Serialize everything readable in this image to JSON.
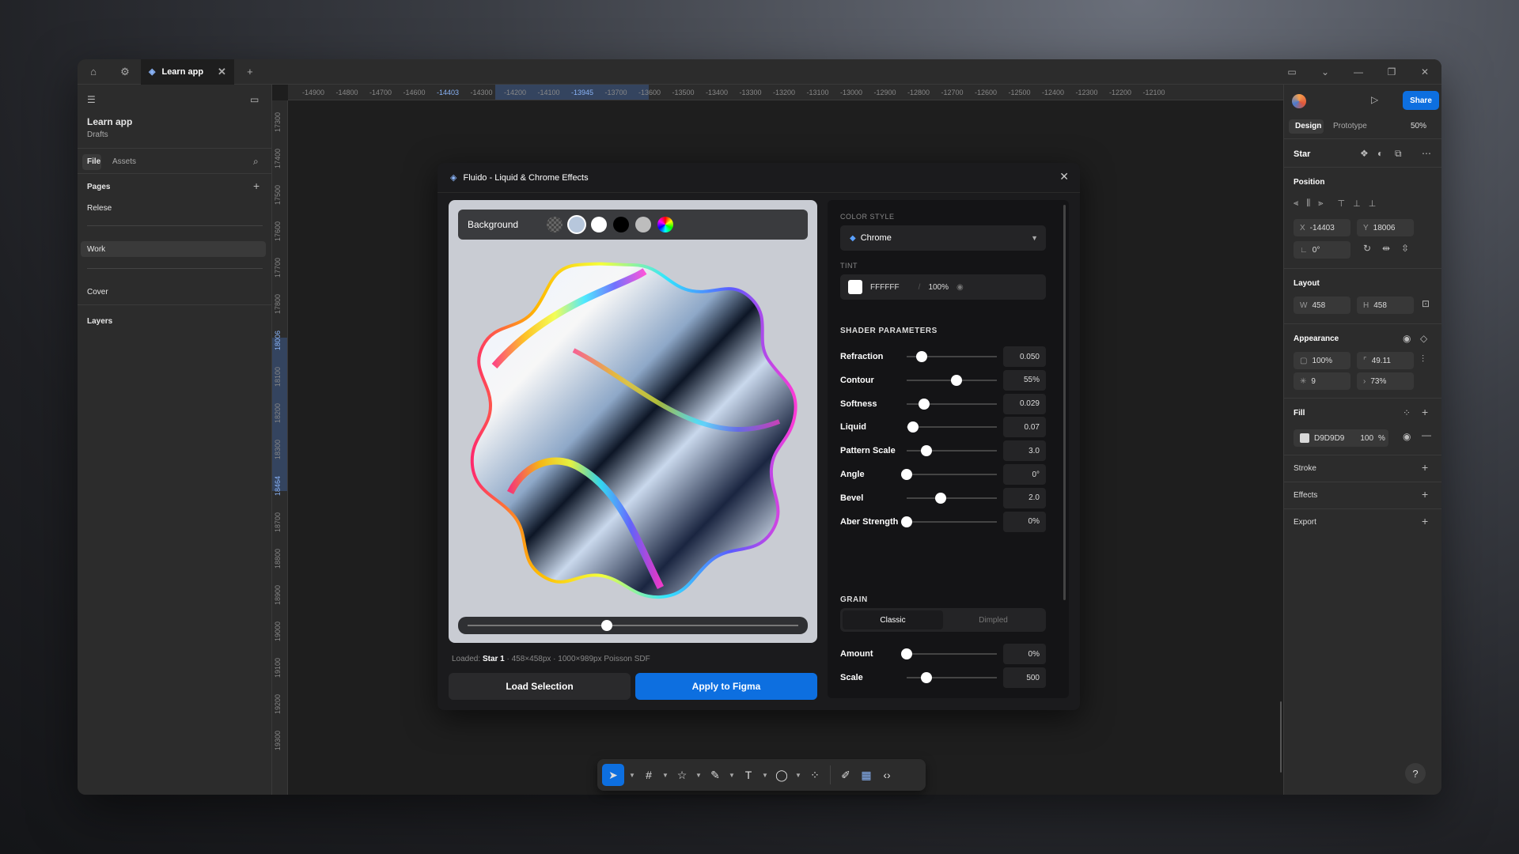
{
  "titlebar": {
    "tab_title": "Learn app",
    "add_tab": "+"
  },
  "ruler": {
    "h_ticks": [
      "-14900",
      "-14800",
      "-14700",
      "-14600",
      "-14403",
      "-14300",
      "-14200",
      "-14100",
      "-13945",
      "-13700",
      "-13600",
      "-13500",
      "-13400",
      "-13300",
      "-13200",
      "-13100",
      "-13000",
      "-12900",
      "-12800",
      "-12700",
      "-12600",
      "-12500",
      "-12400",
      "-12300",
      "-12200",
      "-12100"
    ],
    "v_ticks": [
      "17300",
      "17400",
      "17500",
      "17600",
      "17700",
      "17800",
      "18006",
      "18100",
      "18200",
      "18300",
      "18464",
      "18700",
      "18800",
      "18900",
      "19000",
      "19100",
      "19200",
      "19300"
    ]
  },
  "left_sidebar": {
    "project": "Learn app",
    "location": "Drafts",
    "tab_file": "File",
    "tab_assets": "Assets",
    "pages_heading": "Pages",
    "pages": [
      "Relese",
      "Work",
      "Cover"
    ],
    "layers_heading": "Layers"
  },
  "plugin": {
    "title": "Fluido - Liquid & Chrome Effects",
    "background_label": "Background",
    "loaded_prefix": "Loaded: ",
    "loaded_name": "Star 1",
    "loaded_info": " · 458×458px · 1000×989px Poisson SDF",
    "load_button": "Load Selection",
    "apply_button": "Apply to Figma",
    "timeline_position": 0.42,
    "color_style_label": "COLOR STYLE",
    "color_style_value": "Chrome",
    "tint_label": "TINT",
    "tint_hex": "FFFFFF",
    "tint_opacity": "100%",
    "shader_heading": "SHADER PARAMETERS",
    "params": [
      {
        "label": "Refraction",
        "value": "0.050",
        "pos": 0.17
      },
      {
        "label": "Contour",
        "value": "55%",
        "pos": 0.55
      },
      {
        "label": "Softness",
        "value": "0.029",
        "pos": 0.19
      },
      {
        "label": "Liquid",
        "value": "0.07",
        "pos": 0.07
      },
      {
        "label": "Pattern Scale",
        "value": "3.0",
        "pos": 0.22
      },
      {
        "label": "Angle",
        "value": "0°",
        "pos": 0.0
      },
      {
        "label": "Bevel",
        "value": "2.0",
        "pos": 0.38
      },
      {
        "label": "Aber Strength",
        "value": "0%",
        "pos": 0.0
      }
    ],
    "grain_heading": "GRAIN",
    "grain_classic": "Classic",
    "grain_dimpled": "Dimpled",
    "grain_params": [
      {
        "label": "Amount",
        "value": "0%",
        "pos": 0.0
      },
      {
        "label": "Scale",
        "value": "500",
        "pos": 0.22
      }
    ]
  },
  "right_sidebar": {
    "share": "Share",
    "tab_design": "Design",
    "tab_prototype": "Prototype",
    "zoom": "50%",
    "layer_name": "Star",
    "position_heading": "Position",
    "x_label": "X",
    "x_value": "-14403",
    "y_label": "Y",
    "y_value": "18006",
    "rotation": "0°",
    "layout_heading": "Layout",
    "w_label": "W",
    "w_value": "458",
    "h_label": "H",
    "h_value": "458",
    "appearance_heading": "Appearance",
    "opacity": "100%",
    "radius": "49.11",
    "count": "9",
    "ratio": "73%",
    "fill_heading": "Fill",
    "fill_hex": "D9D9D9",
    "fill_opacity": "100",
    "fill_pct": "%",
    "stroke_heading": "Stroke",
    "effects_heading": "Effects",
    "export_heading": "Export"
  },
  "help": "?"
}
